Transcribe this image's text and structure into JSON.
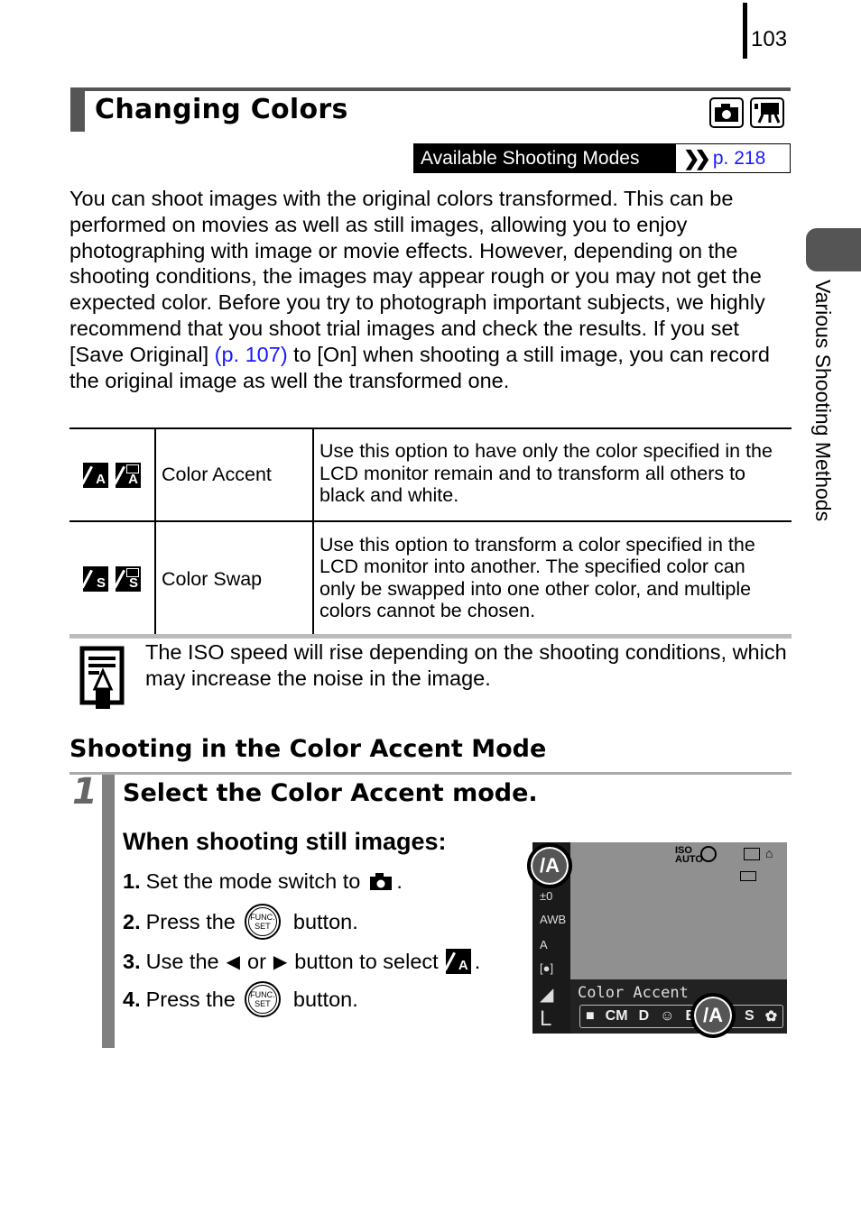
{
  "page_number": "103",
  "title": "Changing Colors",
  "mode_icons": [
    "camera-still-icon",
    "movie-camera-icon"
  ],
  "available_modes": {
    "label": "Available Shooting Modes",
    "ref": "p. 218"
  },
  "side_tab": "Various Shooting Methods",
  "intro": {
    "before_link": "You can shoot images with the original colors transformed. This can be performed on movies as well as still images, allowing you to enjoy photographing with image or movie effects. However, depending on the shooting conditions, the images may appear rough or you may not get the expected color. Before you try to photograph important subjects, we highly recommend that you shoot trial images and check the results. If you set [Save Original] ",
    "link": "(p. 107)",
    "after_link": " to [On] when shooting a still image, you can record the original image as well the transformed one."
  },
  "options": [
    {
      "icons": [
        "color-accent-still-icon",
        "color-accent-movie-icon"
      ],
      "icon_letter": "A",
      "name": "Color Accent",
      "description": "Use this option to have only the color specified in the LCD monitor remain and to transform all others to black and white."
    },
    {
      "icons": [
        "color-swap-still-icon",
        "color-swap-movie-icon"
      ],
      "icon_letter": "S",
      "name": "Color Swap",
      "description": "Use this option to transform a color specified in the LCD monitor into another. The specified color can only be swapped into one other color, and multiple colors cannot be chosen."
    }
  ],
  "note": "The ISO speed will rise depending on the shooting conditions, which may increase the noise in the image.",
  "section_heading": "Shooting in the Color Accent Mode",
  "step": {
    "number": "1",
    "title": "Select the Color Accent mode.",
    "subheading": "When shooting still images:",
    "instructions": [
      {
        "num": "1.",
        "text_before": "Set the mode switch to",
        "text_after": "."
      },
      {
        "num": "2.",
        "text_before": "Press the",
        "text_after": "button."
      },
      {
        "num": "3.",
        "text_before": "Use the",
        "mid": "or",
        "text_mid2": "button to select",
        "text_after": "."
      },
      {
        "num": "4.",
        "text_before": "Press the",
        "text_after": "button."
      }
    ],
    "func_button": {
      "line1": "FUNC.",
      "line2": "SET"
    }
  },
  "lcd": {
    "mode_label": "Color Accent",
    "left_column": [
      "±0",
      "AWB",
      "A",
      "[●]",
      "◢",
      "L"
    ],
    "top_icons": [
      "ISO AUTO",
      "flash-off",
      "frame",
      "lock"
    ],
    "bottom_icons": [
      "camera",
      "CM",
      "D",
      "portrait",
      "B",
      "A",
      "S",
      "effect"
    ]
  }
}
